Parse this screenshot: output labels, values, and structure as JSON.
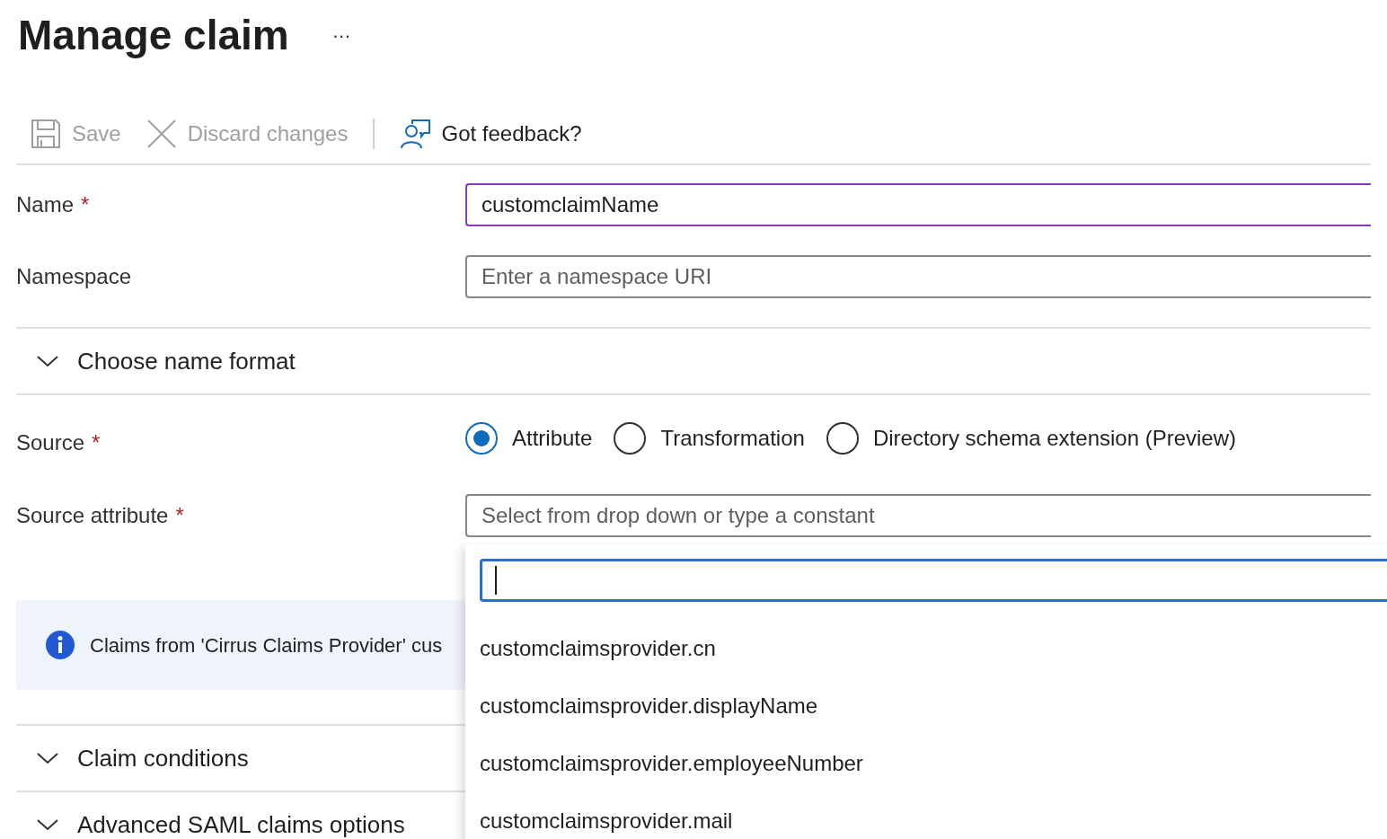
{
  "title": "Manage claim",
  "more": "···",
  "toolbar": [
    {
      "kind": "save",
      "label": "Save",
      "disabled": true
    },
    {
      "kind": "discard",
      "label": "Discard changes",
      "disabled": true
    },
    {
      "kind": "feedback",
      "label": "Got feedback?",
      "disabled": false
    }
  ],
  "name": {
    "label": "Name",
    "required_mark": "*",
    "value": "customclaimName"
  },
  "namespace": {
    "label": "Namespace",
    "placeholder": "Enter a namespace URI"
  },
  "name_format": {
    "label": "Choose name format",
    "expanded": false
  },
  "source": {
    "label": "Source",
    "required_mark": "*",
    "options": [
      {
        "label": "Attribute",
        "selected": true
      },
      {
        "label": "Transformation",
        "selected": false
      },
      {
        "label": "Directory schema extension (Preview)",
        "selected": false
      }
    ]
  },
  "source_attribute": {
    "label": "Source attribute",
    "required_mark": "*",
    "placeholder": "Select from drop down or type a constant"
  },
  "info": "Claims from 'Cirrus Claims Provider' cus",
  "sections": [
    {
      "label": "Claim conditions",
      "expanded": false
    },
    {
      "label": "Advanced SAML claims options",
      "expanded": false
    }
  ],
  "dropdown": {
    "options": [
      "customclaimsprovider.cn",
      "customclaimsprovider.displayName",
      "customclaimsprovider.employeeNumber",
      "customclaimsprovider.mail"
    ]
  }
}
